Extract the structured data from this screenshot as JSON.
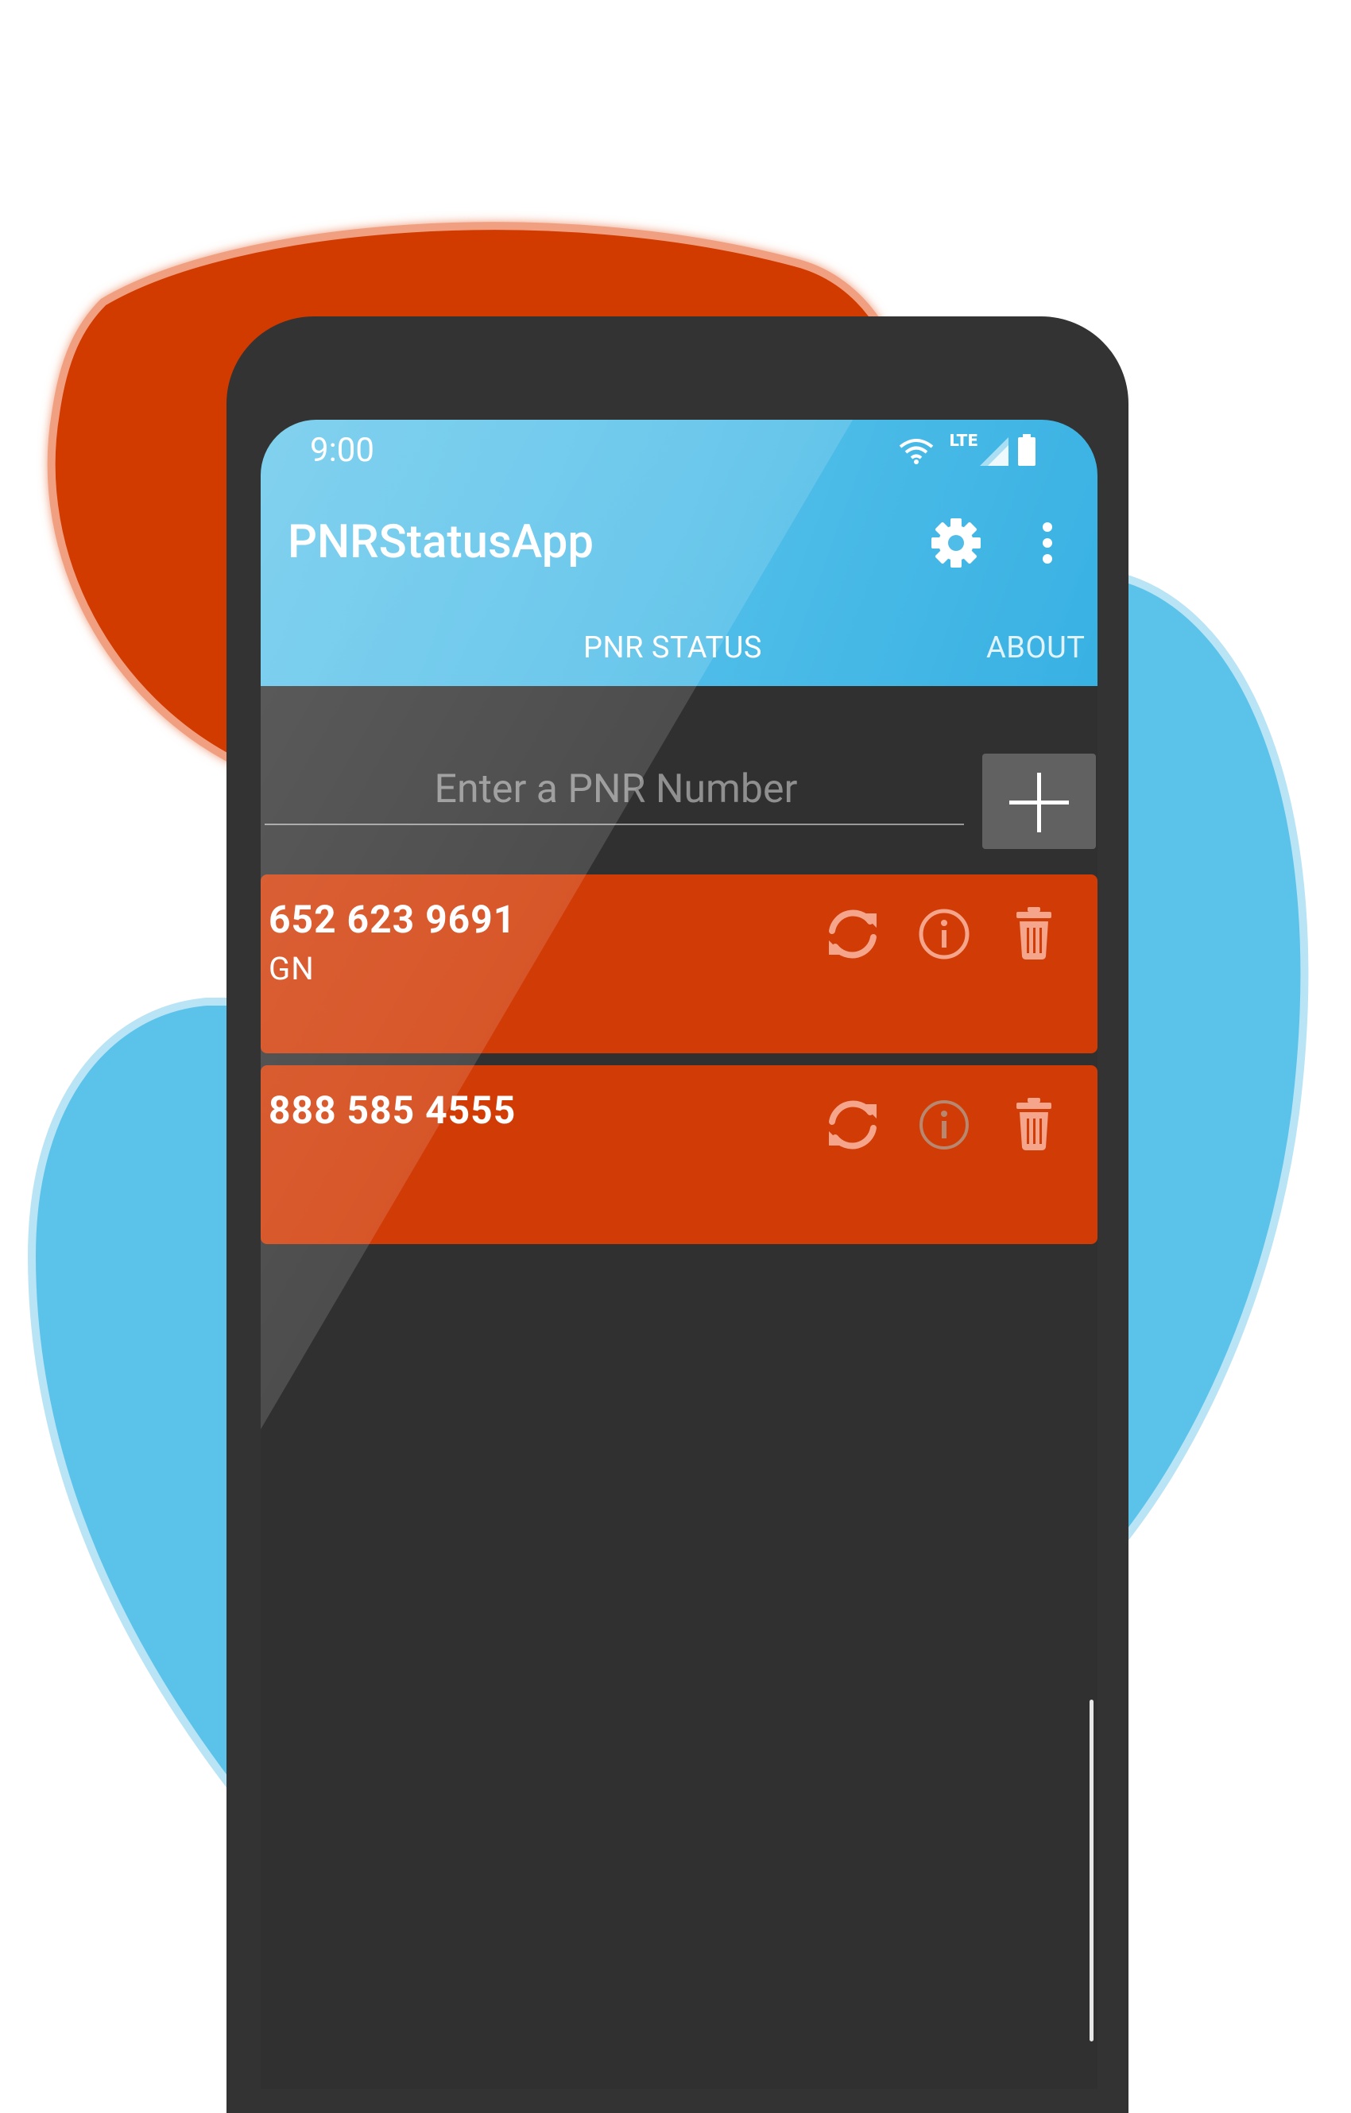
{
  "colors": {
    "accent_blue": "#4fbde8",
    "accent_orange": "#d13b06",
    "screen_bg": "#303030",
    "phone_frame": "#333333",
    "add_button": "#616161"
  },
  "status_bar": {
    "time": "9:00",
    "network_label": "LTE",
    "icons": [
      "wifi-icon",
      "cell-signal-icon",
      "battery-icon"
    ]
  },
  "app_bar": {
    "title": "PNRStatusApp",
    "actions": [
      "gear-icon",
      "more-vert-icon"
    ]
  },
  "tabs": [
    {
      "label": "PNR STATUS",
      "selected": true
    },
    {
      "label": "ABOUT",
      "selected": false
    }
  ],
  "pnr_entry": {
    "placeholder": "Enter a PNR Number",
    "value": "",
    "add_icon": "plus-icon"
  },
  "pnr_cards": [
    {
      "pnr": "652 623 9691",
      "class_code": "GN",
      "info_enabled": true
    },
    {
      "pnr": "888 585 4555",
      "class_code": "",
      "info_enabled": false
    }
  ],
  "card_actions": [
    "refresh-icon",
    "info-icon",
    "delete-icon"
  ]
}
